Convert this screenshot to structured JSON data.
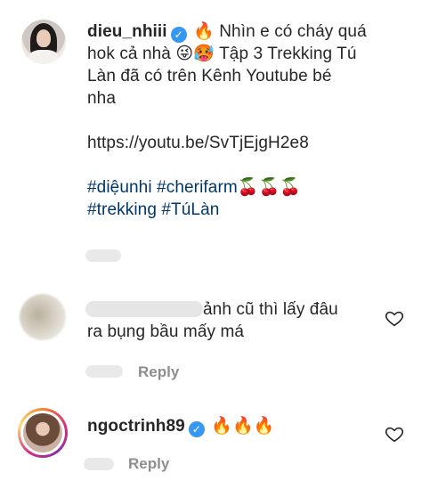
{
  "post_comment": {
    "username": "dieu_nhiii",
    "verified_glyph": "✓",
    "fire_emoji": "🔥",
    "line1_text": "Nhìn e có cháy quá",
    "line2_text_before": "hok cả nhà",
    "emoji_pair": "😜🥵",
    "line2_text_after": "Tập 3 Trekking Tú",
    "line3_text": "Làn đã có trên Kênh Youtube bé",
    "line4_text": "nha",
    "link": "https://youtu.be/SvTjEjgH2e8",
    "hashtag_1": "#diệunhi",
    "hashtag_2": "#cherifarm",
    "cherries": "🍒🍒🍒",
    "hashtag_3": "#trekking",
    "hashtag_4": "#TúLàn"
  },
  "comment_2": {
    "text_1": "ảnh cũ thì lấy đâu",
    "text_2": "ra bụng bầu mấy má",
    "reply_label": "Reply",
    "icon": "heart-icon"
  },
  "comment_3": {
    "username": "ngoctrinh89",
    "verified_glyph": "✓",
    "fires": "🔥🔥🔥",
    "reply_label": "Reply",
    "icon": "heart-icon"
  },
  "colors": {
    "text": "#262626",
    "hashtag": "#00376b",
    "muted": "#8e8e8e",
    "verified": "#3897f0"
  }
}
